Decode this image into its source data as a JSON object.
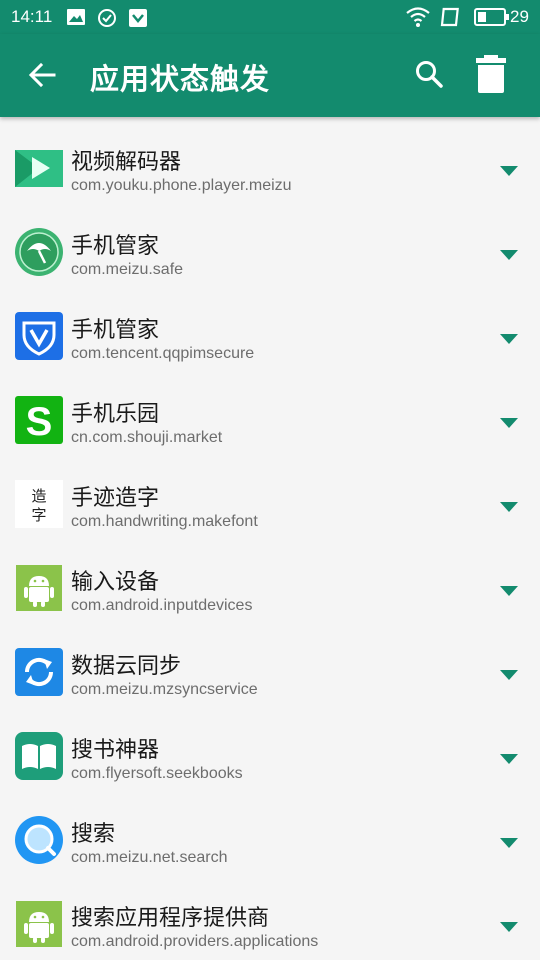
{
  "status_bar": {
    "time": "14:11",
    "battery": "29"
  },
  "app_bar": {
    "title": "应用状态触发",
    "back_icon": "arrow-back-icon",
    "search_icon": "search-icon",
    "delete_icon": "trash-icon"
  },
  "colors": {
    "primary": "#138b6e",
    "background": "#f5f5f5"
  },
  "apps": [
    {
      "name": "视频解码器",
      "package": "com.youku.phone.player.meizu",
      "icon": "video-decoder-icon"
    },
    {
      "name": "手机管家",
      "package": "com.meizu.safe",
      "icon": "meizu-safe-icon"
    },
    {
      "name": "手机管家",
      "package": "com.tencent.qqpimsecure",
      "icon": "tencent-shield-icon"
    },
    {
      "name": "手机乐园",
      "package": "cn.com.shouji.market",
      "icon": "shouji-market-icon"
    },
    {
      "name": "手迹造字",
      "package": "com.handwriting.makefont",
      "icon": "handwriting-icon"
    },
    {
      "name": "输入设备",
      "package": "com.android.inputdevices",
      "icon": "android-icon"
    },
    {
      "name": "数据云同步",
      "package": "com.meizu.mzsyncservice",
      "icon": "sync-icon"
    },
    {
      "name": "搜书神器",
      "package": "com.flyersoft.seekbooks",
      "icon": "book-icon"
    },
    {
      "name": "搜索",
      "package": "com.meizu.net.search",
      "icon": "search-app-icon"
    },
    {
      "name": "搜索应用程序提供商",
      "package": "com.android.providers.applications",
      "icon": "android-icon"
    }
  ],
  "icon_glyphs": {
    "shouji_s": "S",
    "handwriting_top": "造",
    "handwriting_bottom": "字"
  }
}
